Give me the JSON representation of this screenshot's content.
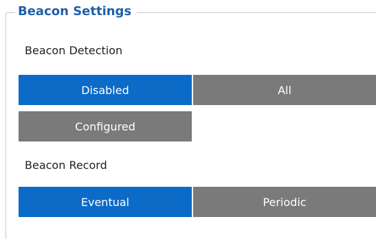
{
  "group": {
    "title": "Beacon Settings"
  },
  "beacon_detection": {
    "label": "Beacon Detection",
    "options": [
      {
        "label": "Disabled",
        "selected": true
      },
      {
        "label": "All",
        "selected": false
      },
      {
        "label": "Configured",
        "selected": false
      }
    ]
  },
  "beacon_record": {
    "label": "Beacon Record",
    "options": [
      {
        "label": "Eventual",
        "selected": true
      },
      {
        "label": "Periodic",
        "selected": false
      }
    ]
  },
  "colors": {
    "selected": "#0b6bc7",
    "unselected": "#7a7a7a",
    "title": "#1f5fa9"
  }
}
